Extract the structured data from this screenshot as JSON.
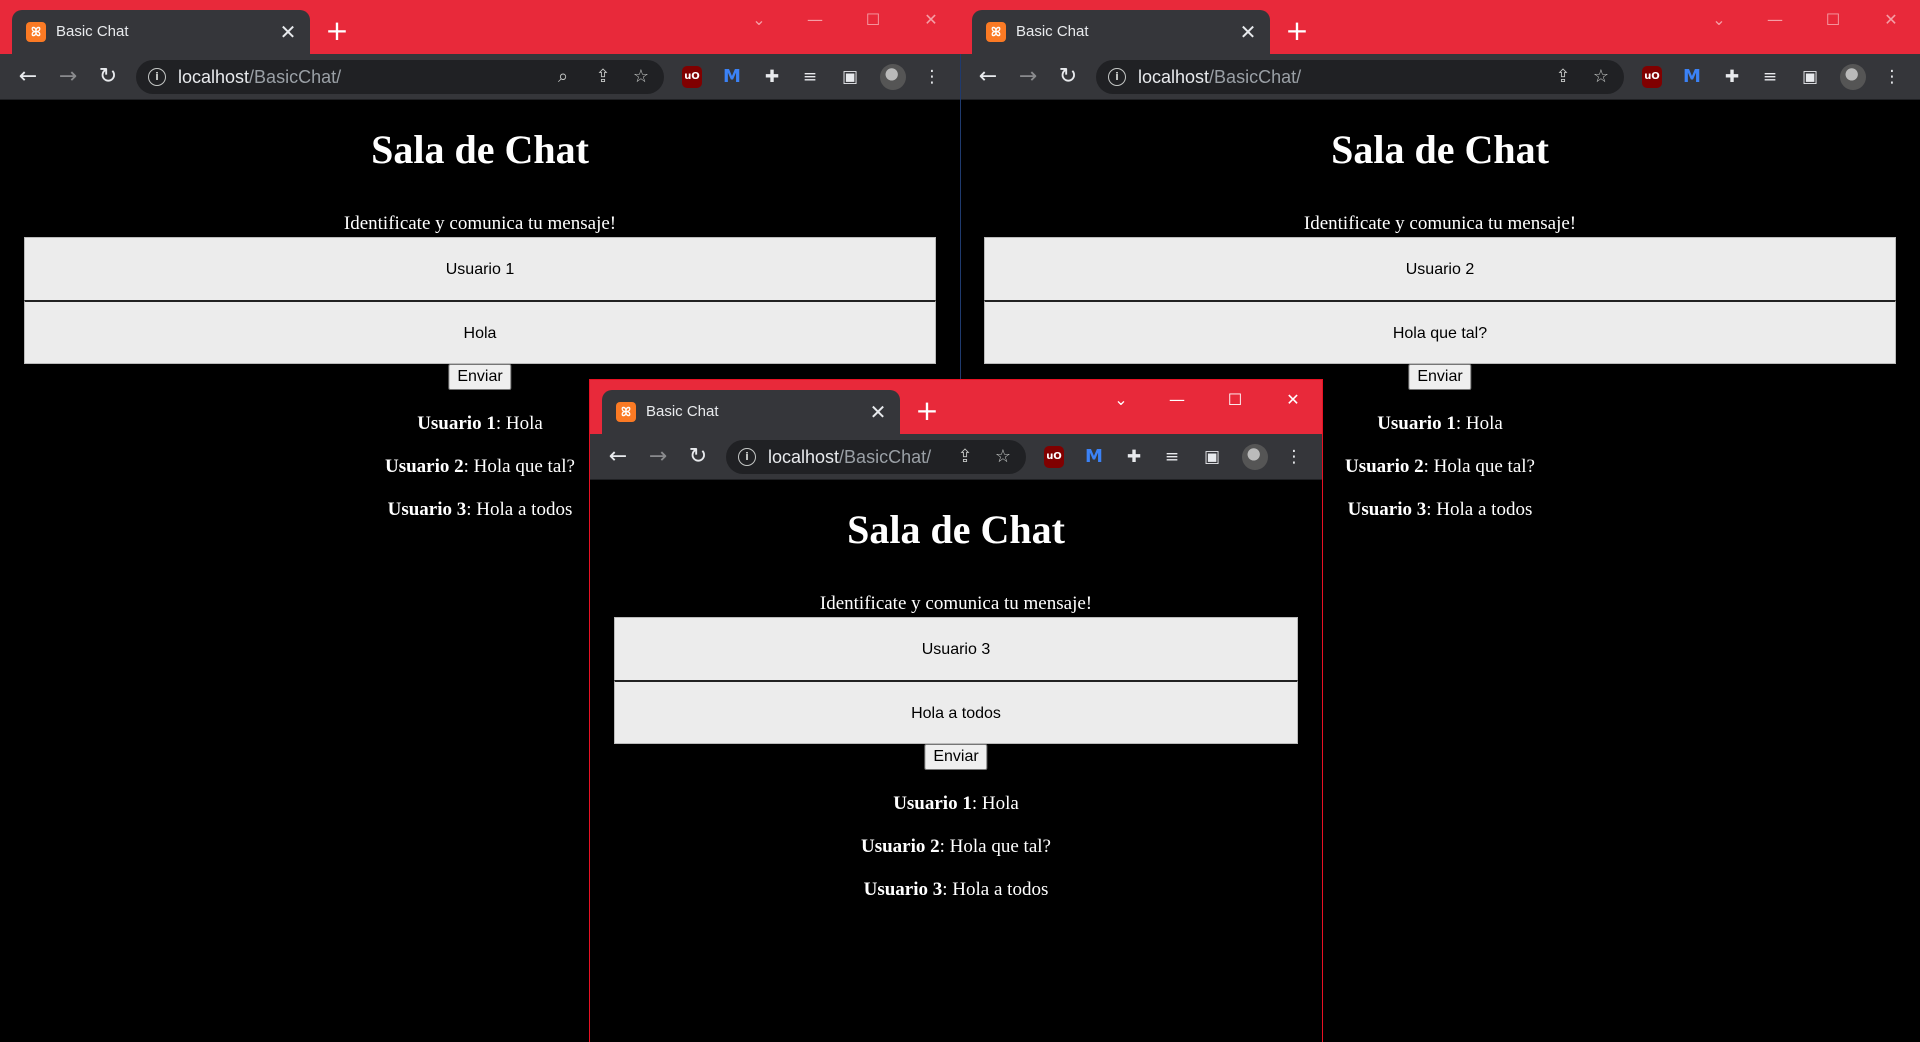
{
  "windows": [
    {
      "tab_title": "Basic Chat",
      "favicon": "xampp-icon",
      "url_host": "localhost",
      "url_path": "/BasicChat/",
      "page": {
        "title": "Sala de Chat",
        "subtitle": "Identificate y comunica tu mensaje!",
        "user_value": "Usuario 1",
        "message_value": "Hola",
        "send_label": "Enviar",
        "messages": [
          {
            "user": "Usuario 1",
            "text": ": Hola"
          },
          {
            "user": "Usuario 2",
            "text": ": Hola que tal?"
          },
          {
            "user": "Usuario 3",
            "text": ": Hola a todos"
          }
        ]
      }
    },
    {
      "tab_title": "Basic Chat",
      "favicon": "xampp-icon",
      "url_host": "localhost",
      "url_path": "/BasicChat/",
      "page": {
        "title": "Sala de Chat",
        "subtitle": "Identificate y comunica tu mensaje!",
        "user_value": "Usuario 2",
        "message_value": "Hola que tal?",
        "send_label": "Enviar",
        "messages": [
          {
            "user": "Usuario 1",
            "text": ": Hola"
          },
          {
            "user": "Usuario 2",
            "text": ": Hola que tal?"
          },
          {
            "user": "Usuario 3",
            "text": ": Hola a todos"
          }
        ]
      }
    },
    {
      "tab_title": "Basic Chat",
      "favicon": "xampp-icon",
      "url_host": "localhost",
      "url_path": "/BasicChat/",
      "page": {
        "title": "Sala de Chat",
        "subtitle": "Identificate y comunica tu mensaje!",
        "user_value": "Usuario 3",
        "message_value": "Hola a todos",
        "send_label": "Enviar",
        "messages": [
          {
            "user": "Usuario 1",
            "text": ": Hola"
          },
          {
            "user": "Usuario 2",
            "text": ": Hola que tal?"
          },
          {
            "user": "Usuario 3",
            "text": ": Hola a todos"
          }
        ]
      }
    }
  ],
  "icons": {
    "new_tab": "+",
    "close": "✕",
    "back": "←",
    "forward": "→",
    "reload": "↻",
    "info": "i",
    "search": "⌕",
    "share": "⇪",
    "star": "☆",
    "ublock": "uO",
    "malwarebytes": "M",
    "extensions": "✚",
    "media": "≡",
    "sidepanel": "▣",
    "menu": "⋮",
    "tab_search": "⌄",
    "minimize": "—",
    "maximize": "☐",
    "window_close": "✕",
    "favicon_glyph": "ꕤ"
  },
  "theme": {
    "titlebar": "#e8293a",
    "tab_bg": "#35363a",
    "page_bg": "#000000",
    "field_bg": "#ececec"
  }
}
